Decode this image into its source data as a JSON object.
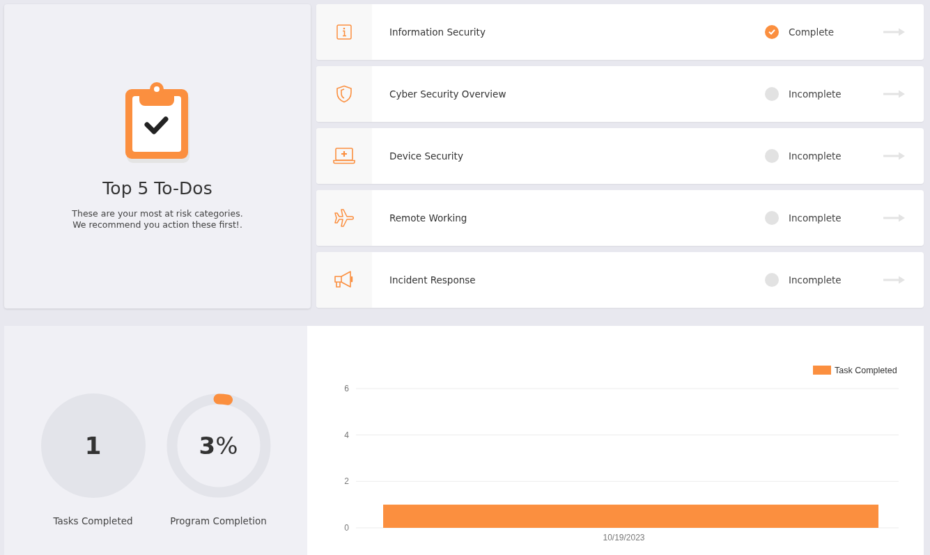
{
  "todos_card": {
    "title": "Top 5 To-Dos",
    "description": "These are your most at risk categories.\nWe recommend you action these first!."
  },
  "todos": [
    {
      "kind": "info",
      "label": "Information Security",
      "status": "Complete",
      "complete": true
    },
    {
      "kind": "shield",
      "label": "Cyber Security Overview",
      "status": "Incomplete",
      "complete": false
    },
    {
      "kind": "laptop",
      "label": "Device Security",
      "status": "Incomplete",
      "complete": false
    },
    {
      "kind": "plane",
      "label": "Remote Working",
      "status": "Incomplete",
      "complete": false
    },
    {
      "kind": "megaphone",
      "label": "Incident Response",
      "status": "Incomplete",
      "complete": false
    }
  ],
  "stats": {
    "tasks_completed": {
      "value": "1",
      "label": "Tasks Completed"
    },
    "program_completion": {
      "value": "**3**%",
      "label": "Program Completion",
      "level": 0.03
    }
  },
  "chart_data": {
    "type": "bar",
    "categories": [
      "10/19/2023"
    ],
    "series": [
      {
        "name": "Task Completed",
        "color": "#fb8f3f",
        "values": [
          1
        ]
      }
    ],
    "ylim": [
      0,
      6
    ],
    "yticks": [
      0,
      2,
      4,
      6
    ]
  }
}
